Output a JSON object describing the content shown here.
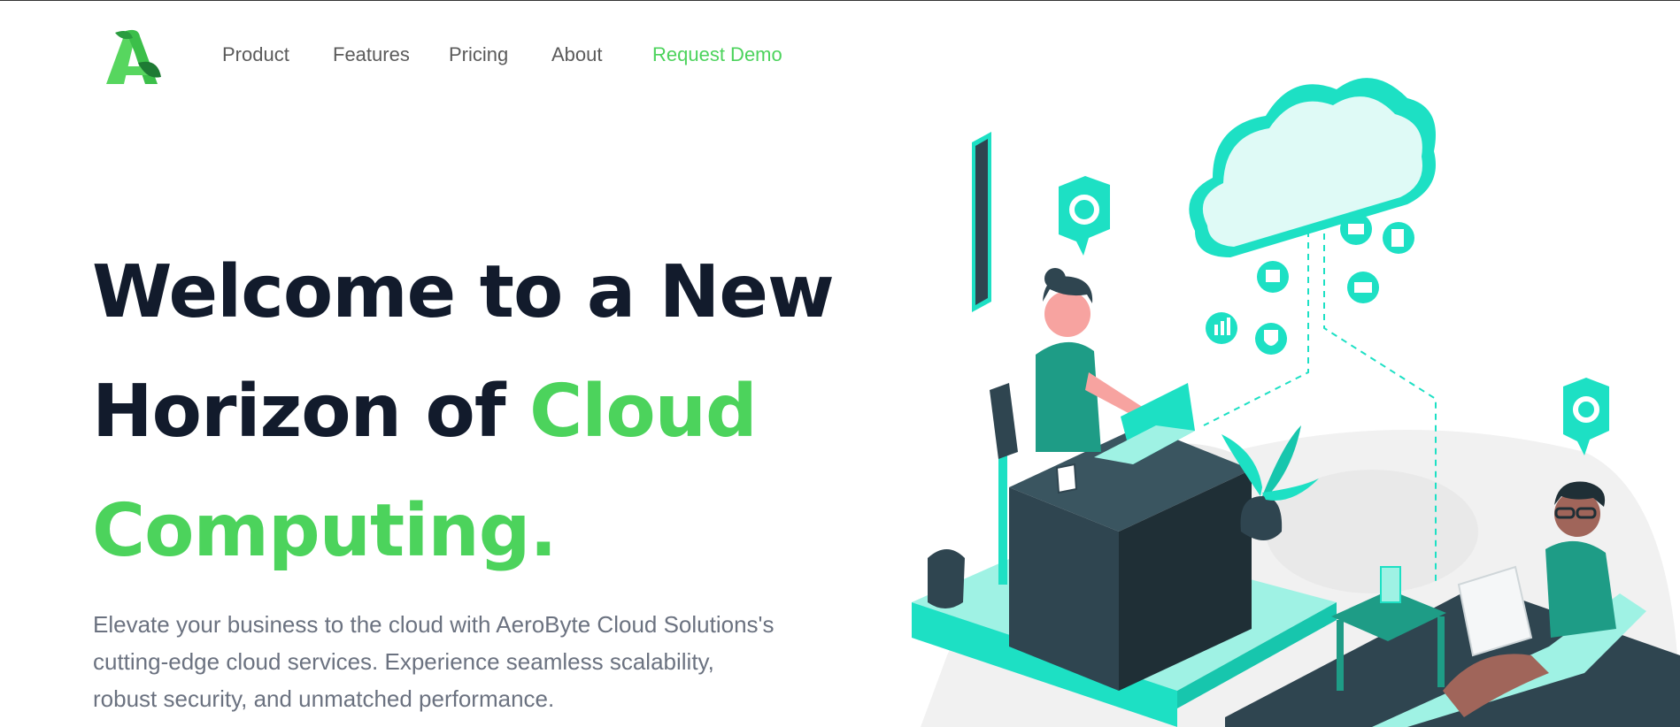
{
  "logo": {
    "letter": "A",
    "icon": "aerobyte-logo-icon"
  },
  "nav": {
    "items": [
      {
        "label": "Product"
      },
      {
        "label": "Features"
      },
      {
        "label": "Pricing"
      },
      {
        "label": "About"
      }
    ],
    "cta": {
      "label": "Request Demo"
    }
  },
  "hero": {
    "title_line1": "Welcome to a New",
    "title_line2_prefix": "Horizon of ",
    "title_line2_accent": "Cloud",
    "title_line3_accent": "Computing.",
    "description": "Elevate your business to the cloud with AeroByte Cloud Solutions's cutting-edge cloud services. Experience seamless scalability, robust security, and unmatched performance."
  },
  "illustration": {
    "icon": "cloud-workspace-illustration"
  },
  "colors": {
    "accent": "#4cd35c",
    "heading": "#121b2c",
    "body_text": "#6b7280",
    "nav_text": "#5b5b5b",
    "teal": "#1de0c4",
    "dark_slate": "#2f4550"
  }
}
